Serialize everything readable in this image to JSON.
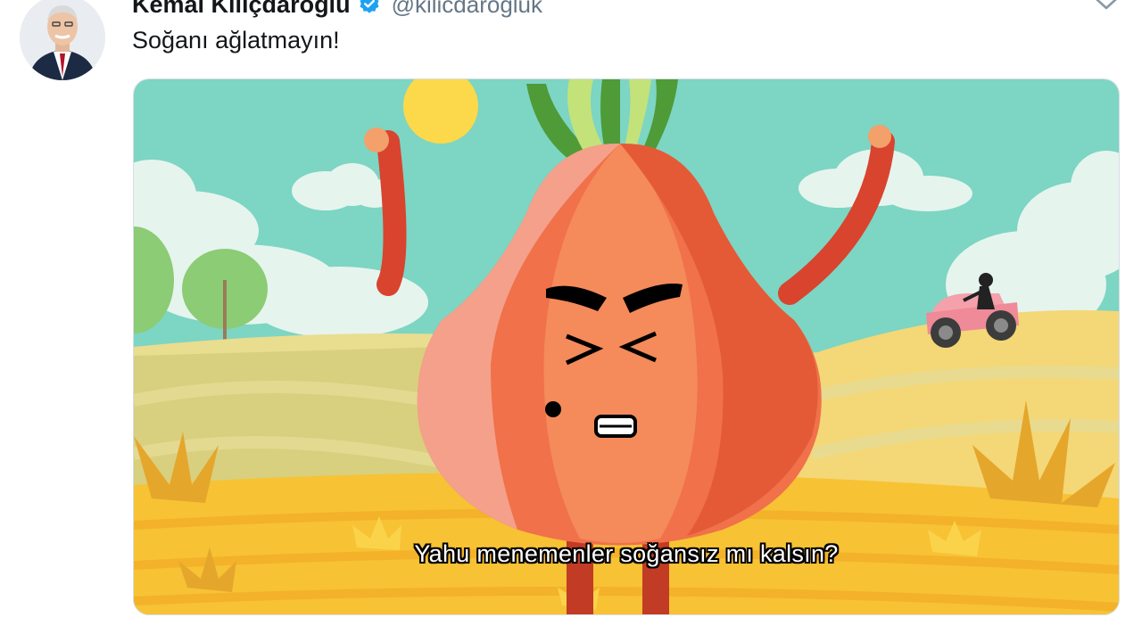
{
  "tweet": {
    "author_name": "Kemal Kılıçdaroğlu",
    "handle": "@kilicdarogluk",
    "verified": true,
    "text": "Soğanı ağlatmayın!"
  },
  "media": {
    "subtitle": "Yahu menemenler soğansız mı kalsın?"
  },
  "colors": {
    "sky": "#7dd5c3",
    "onion": "#f0714a",
    "verified_badge": "#1da1f2",
    "field": "#f6c633"
  },
  "icons": {
    "verified": "verified-badge-icon",
    "menu": "chevron-down-icon"
  }
}
